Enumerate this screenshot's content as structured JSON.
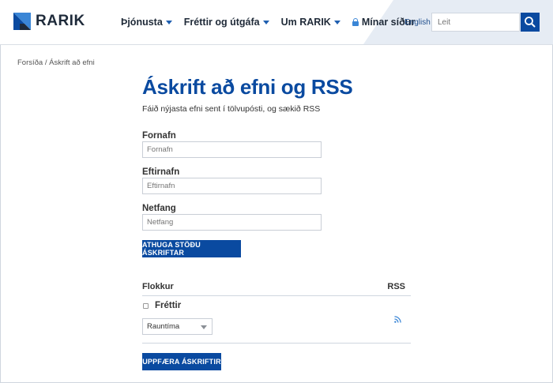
{
  "header": {
    "logo_text": "RARIK",
    "nav": [
      {
        "label": "Þjónusta",
        "has_dropdown": true
      },
      {
        "label": "Fréttir og útgáfa",
        "has_dropdown": true
      },
      {
        "label": "Um RARIK",
        "has_dropdown": true
      },
      {
        "label": "Mínar síður",
        "icon": "lock-icon"
      }
    ],
    "language_link": "English",
    "search": {
      "placeholder": "Leit",
      "icon": "search-icon"
    }
  },
  "breadcrumb": "Forsíða / Áskrift að efni",
  "page": {
    "title": "Áskrift að efni og RSS",
    "subtitle": "Fáið nýjasta efni sent í tölvupósti, og sækið RSS"
  },
  "form": {
    "first_name": {
      "label": "Fornafn",
      "placeholder": "Fornafn"
    },
    "last_name": {
      "label": "Eftirnafn",
      "placeholder": "Eftirnafn"
    },
    "email": {
      "label": "Netfang",
      "placeholder": "Netfang"
    },
    "check_status_button": "ATHUGA STÖÐU ÁSKRIFTAR"
  },
  "subscriptions": {
    "header_category": "Flokkur",
    "header_rss": "RSS",
    "items": [
      {
        "category": "Fréttir",
        "checked": false,
        "frequency": "Rauntíma",
        "rss_icon": "rss-icon"
      }
    ],
    "update_button": "UPPFÆRA ÁSKRIFTIR"
  },
  "colors": {
    "brand_blue": "#0a4aa0",
    "accent_blue": "#1f5fb0",
    "header_tint": "#e6ecf4"
  }
}
